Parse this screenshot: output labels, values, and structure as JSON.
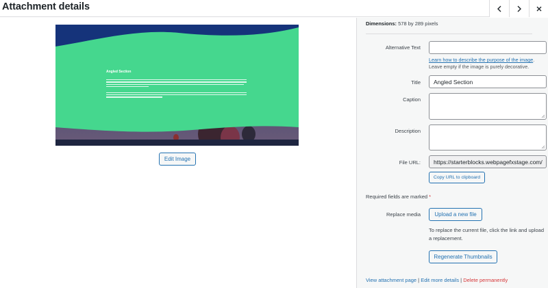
{
  "header": {
    "title": "Attachment details",
    "prev_icon": "chevron-left-icon",
    "next_icon": "chevron-right-icon",
    "close_icon": "close-icon"
  },
  "preview": {
    "image_heading": "Angled Section",
    "edit_button": "Edit Image",
    "colors": {
      "top": "#1d3a7a",
      "band": "#45d78e"
    }
  },
  "details": {
    "dimensions_label": "Dimensions:",
    "dimensions_value": "578 by 289 pixels",
    "alt_text": {
      "label": "Alternative Text",
      "value": "",
      "help_link": "Learn how to describe the purpose of the image",
      "help_suffix": ".",
      "help_rest": "Leave empty if the image is purely decorative."
    },
    "title": {
      "label": "Title",
      "value": "Angled Section"
    },
    "caption": {
      "label": "Caption",
      "value": ""
    },
    "description": {
      "label": "Description",
      "value": ""
    },
    "file_url": {
      "label": "File URL:",
      "value": "https://starterblocks.webpagefxstage.com/",
      "copy_button": "Copy URL to clipboard"
    },
    "required_note": "Required fields are marked",
    "required_mark": "*",
    "replace": {
      "label": "Replace media",
      "button": "Upload a new file",
      "help": "To replace the current file, click the link and upload a replacement."
    },
    "regenerate_button": "Regenerate Thumbnails"
  },
  "footer": {
    "view_link": "View attachment page",
    "sep1": "|",
    "edit_link": "Edit more details",
    "sep2": "|",
    "delete_link": "Delete permanently"
  }
}
